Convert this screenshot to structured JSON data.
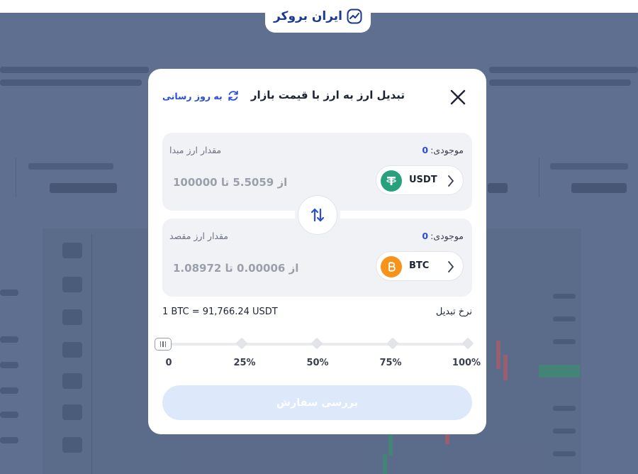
{
  "logo": {
    "text": "ایران بروکر",
    "icon": "trend-chart-icon"
  },
  "modal": {
    "title": "تبدیل ارز به ارز با قیمت بازار",
    "refresh_label": "به روز رسانی",
    "close_icon": "close-icon",
    "source": {
      "balance_label": "موجودی:",
      "balance_value": "0",
      "amount_label": "مقدار ارز مبدا",
      "range_text": "از 5.5059 تا 100000",
      "coin_code": "USDT",
      "coin_icon": "tether-icon"
    },
    "destination": {
      "balance_label": "موجودی:",
      "balance_value": "0",
      "amount_label": "مقدار ارز مقصد",
      "range_text": "از 0.00006 تا 1.08972",
      "coin_code": "BTC",
      "coin_icon": "bitcoin-icon"
    },
    "rate": {
      "label": "نرخ تبدیل",
      "value": "1 BTC = 91,766.24 USDT"
    },
    "slider": {
      "ticks": [
        "0",
        "25%",
        "50%",
        "75%",
        "100%"
      ],
      "current_percent": 0
    },
    "submit_label": "بررسی سفارش"
  },
  "colors": {
    "accent": "#2a4fd6",
    "submit_disabled": "#dde9fb",
    "usdt": "#26a17b",
    "btc": "#f7931a",
    "backdrop": "#5f6f8f"
  }
}
